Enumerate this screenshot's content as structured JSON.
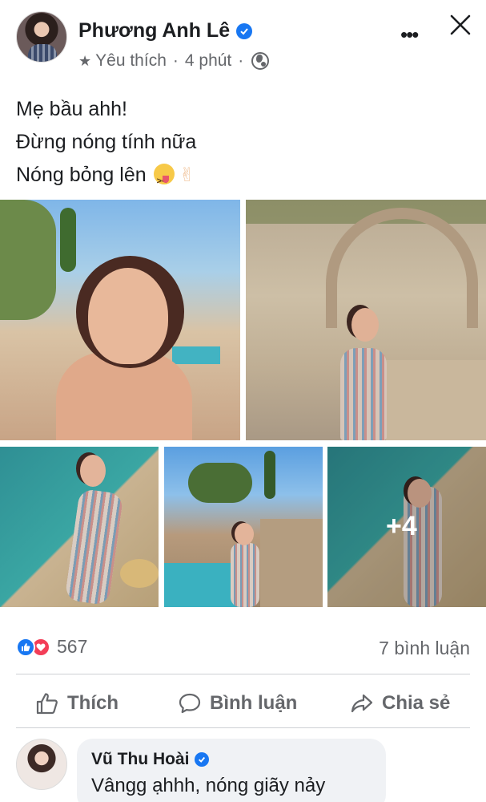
{
  "post": {
    "author": "Phương Anh Lê",
    "audience_label": "Yêu thích",
    "time": "4 phút",
    "separator": "·",
    "more_label": "•••",
    "text_lines": [
      "Mẹ bầu ahh!",
      "Đừng nóng tính nữa",
      "Nóng bỏng lên"
    ],
    "emoji_icons": [
      "squinting-tongue-emoji-icon",
      "victory-hand-emoji-icon"
    ],
    "extra_photos_label": "+4"
  },
  "stats": {
    "reaction_icons": [
      "like-icon",
      "love-icon"
    ],
    "reaction_count": "567",
    "comment_count": "7 bình luận"
  },
  "actions": {
    "like": "Thích",
    "comment": "Bình luận",
    "share": "Chia sẻ"
  },
  "comment": {
    "author": "Vũ Thu Hoài",
    "text": "Vângg ạhhh, nóng giãy nảy"
  },
  "colors": {
    "brand_blue": "#1877f2",
    "love_red": "#f33e58",
    "text_primary": "#1c1e21",
    "text_secondary": "#65676b",
    "comment_bg": "#f0f2f5"
  }
}
